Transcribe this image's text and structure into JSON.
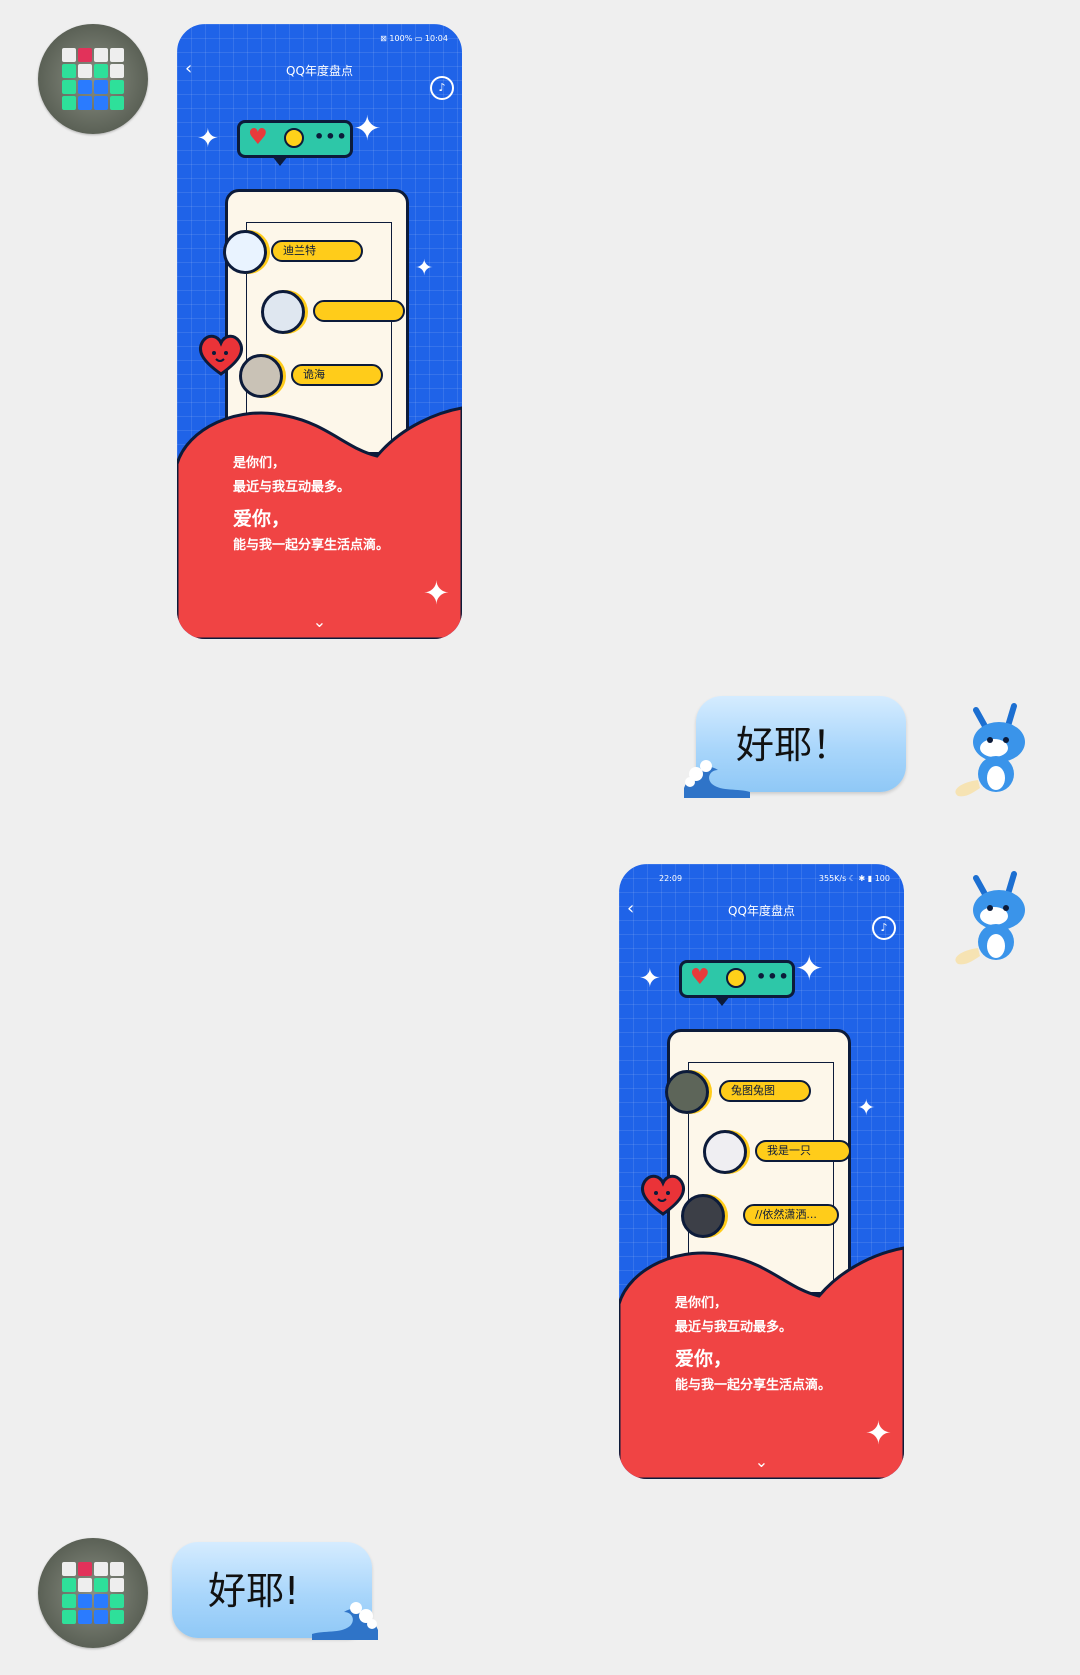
{
  "colors": {
    "card_blue": "#1f63e8",
    "card_red": "#f04444",
    "pill_yellow": "#ffcc1a",
    "bubble_blue": "#a9d6fb"
  },
  "messages": [
    {
      "side": "left",
      "type": "card",
      "card": {
        "status_left": "",
        "status_right": "⊠ 100% ▭ 10:04",
        "title": "QQ年度盘点",
        "friends": [
          "迪兰特",
          "",
          "诡海"
        ],
        "line1": "是你们，",
        "line2": "最近与我互动最多。",
        "line3": "爱你，",
        "line4": "能与我一起分享生活点滴。"
      }
    },
    {
      "side": "right",
      "type": "text",
      "text": "好耶！"
    },
    {
      "side": "right",
      "type": "card",
      "card": {
        "status_left": "22:09",
        "status_right": "355K/s ☾ ✱ ▮ 100",
        "title": "QQ年度盘点",
        "friends": [
          "兔图兔图",
          "我是一只",
          "//依然潇洒..."
        ],
        "line1": "是你们，",
        "line2": "最近与我互动最多。",
        "line3": "爱你，",
        "line4": "能与我一起分享生活点滴。"
      }
    },
    {
      "side": "left",
      "type": "text",
      "text": "好耶!"
    }
  ]
}
